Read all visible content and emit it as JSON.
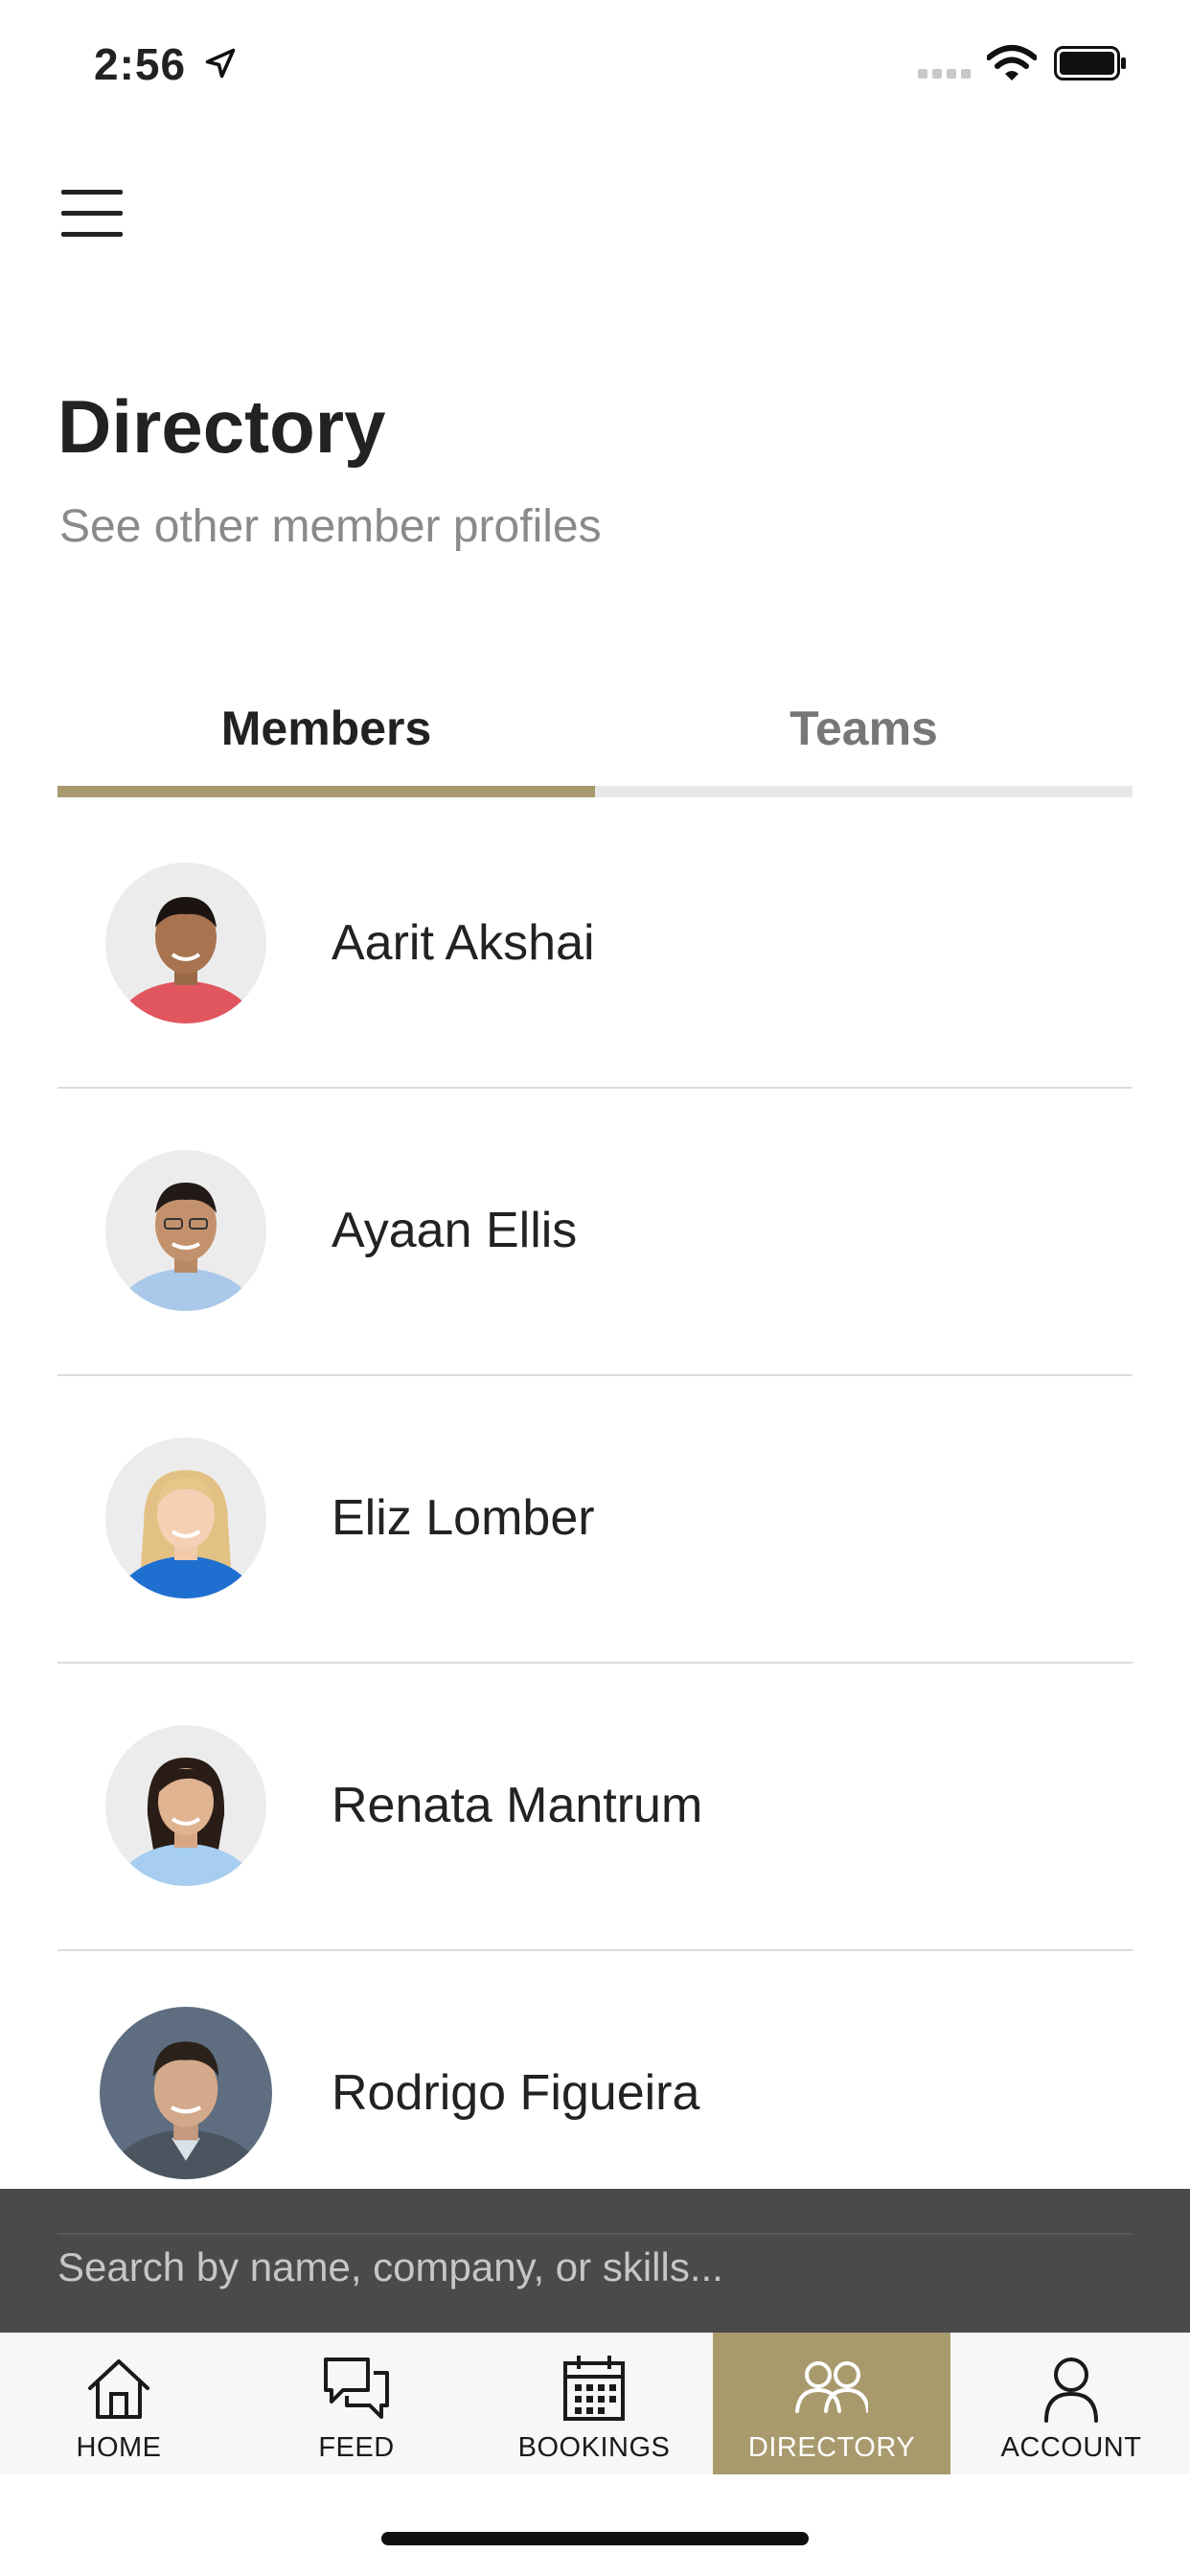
{
  "status_bar": {
    "time": "2:56",
    "icons": [
      "location-arrow-icon",
      "signal-icon",
      "wifi-icon",
      "battery-icon"
    ]
  },
  "header": {
    "menu_icon": "hamburger-menu-icon",
    "title": "Directory",
    "subtitle": "See other member profiles"
  },
  "tabs": [
    {
      "label": "Members",
      "active": true
    },
    {
      "label": "Teams",
      "active": false
    }
  ],
  "members": [
    {
      "name": "Aarit Akshai"
    },
    {
      "name": "Ayaan Ellis"
    },
    {
      "name": "Eliz Lomber"
    },
    {
      "name": "Renata Mantrum"
    },
    {
      "name": "Rodrigo Figueira"
    }
  ],
  "search": {
    "placeholder": "Search by name, company, or skills..."
  },
  "bottom_nav": [
    {
      "label": "HOME",
      "icon": "home-icon",
      "active": false
    },
    {
      "label": "FEED",
      "icon": "chat-bubbles-icon",
      "active": false
    },
    {
      "label": "BOOKINGS",
      "icon": "calendar-icon",
      "active": false
    },
    {
      "label": "DIRECTORY",
      "icon": "people-icon",
      "active": true
    },
    {
      "label": "ACCOUNT",
      "icon": "user-icon",
      "active": false
    }
  ],
  "colors": {
    "accent": "#a89a6c",
    "tab_inactive_line": "#e8e8e8",
    "search_overlay": "#3c3c3c"
  }
}
